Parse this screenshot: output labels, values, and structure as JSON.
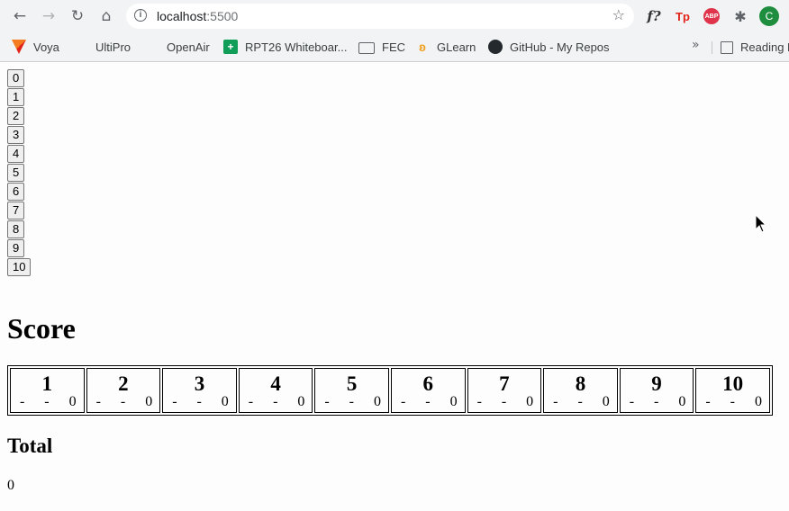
{
  "browser": {
    "url_host": "localhost",
    "url_port": ":5500",
    "avatar_letter": "C",
    "extensions": {
      "f_label": "f?",
      "tp_label": "Tp",
      "abp_label": "ABP"
    },
    "bookmarks": [
      {
        "label": "Voya",
        "icon": "voya-icon"
      },
      {
        "label": "UltiPro",
        "icon": "microsoft-icon"
      },
      {
        "label": "OpenAir",
        "icon": "microsoft-icon"
      },
      {
        "label": "RPT26 Whiteboar...",
        "icon": "plus-sheet-icon"
      },
      {
        "label": "FEC",
        "icon": "folder-icon"
      },
      {
        "label": "GLearn",
        "icon": "glearn-icon"
      },
      {
        "label": "GitHub - My Repos",
        "icon": "github-icon"
      }
    ],
    "bookmarks_more": "»",
    "reading_list_label": "Reading L"
  },
  "page": {
    "pin_buttons": [
      "0",
      "1",
      "2",
      "3",
      "4",
      "5",
      "6",
      "7",
      "8",
      "9",
      "10"
    ],
    "score_heading": "Score",
    "frames": [
      {
        "number": "1",
        "roll1": "-",
        "roll2": "-",
        "score": "0"
      },
      {
        "number": "2",
        "roll1": "-",
        "roll2": "-",
        "score": "0"
      },
      {
        "number": "3",
        "roll1": "-",
        "roll2": "-",
        "score": "0"
      },
      {
        "number": "4",
        "roll1": "-",
        "roll2": "-",
        "score": "0"
      },
      {
        "number": "5",
        "roll1": "-",
        "roll2": "-",
        "score": "0"
      },
      {
        "number": "6",
        "roll1": "-",
        "roll2": "-",
        "score": "0"
      },
      {
        "number": "7",
        "roll1": "-",
        "roll2": "-",
        "score": "0"
      },
      {
        "number": "8",
        "roll1": "-",
        "roll2": "-",
        "score": "0"
      },
      {
        "number": "9",
        "roll1": "-",
        "roll2": "-",
        "score": "0"
      },
      {
        "number": "10",
        "roll1": "-",
        "roll2": "-",
        "score": "0"
      }
    ],
    "total_heading": "Total",
    "total_value": "0"
  }
}
